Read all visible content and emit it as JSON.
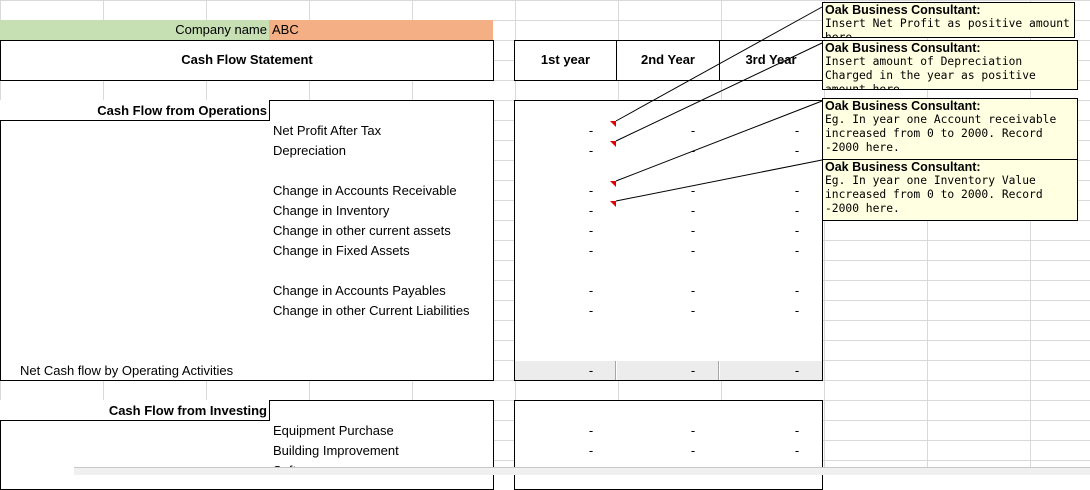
{
  "company": {
    "label": "Company name",
    "value": "ABC"
  },
  "statement_title": "Cash Flow Statement",
  "year_headers": [
    "1st year",
    "2nd Year",
    "3rd Year"
  ],
  "operations": {
    "title": "Cash Flow from Operations",
    "rows": [
      "Net Profit After Tax",
      "Depreciation",
      "Change in Accounts Receivable",
      "Change in Inventory",
      "Change in other current assets",
      "Change in Fixed Assets",
      "Change in Accounts Payables",
      "Change in other Current Liabilities"
    ],
    "total_label": "Net Cash flow by Operating Activities"
  },
  "investing": {
    "title": "Cash Flow from Investing",
    "rows": [
      "Equipment Purchase",
      "Building Improvement",
      "Software"
    ]
  },
  "dash": "-",
  "comments": [
    {
      "author": "Oak Business Consultant:",
      "text": "Insert Net Profit as positive amount here."
    },
    {
      "author": "Oak Business Consultant:",
      "text": "Insert amount of Depreciation Charged in the year as positive amount here."
    },
    {
      "author": "Oak Business Consultant:",
      "text": "Eg. In year one Account receivable increased from 0 to 2000. Record -2000 here."
    },
    {
      "author": "Oak Business Consultant:",
      "text": "Eg. In year one Inventory Value increased from 0 to 2000. Record -2000 here."
    }
  ],
  "colors": {
    "company_label_bg": "#c6e0b4",
    "company_value_bg": "#f4b084",
    "note_bg": "#ffffe1",
    "comment_marker": "#e00000"
  }
}
